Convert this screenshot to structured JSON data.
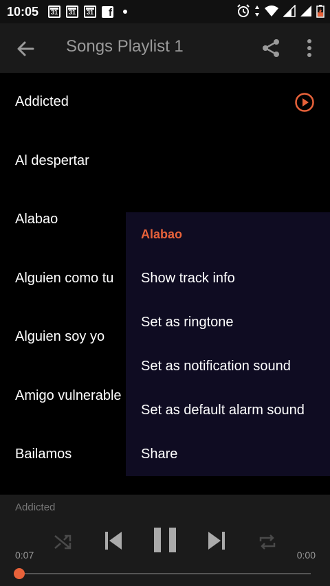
{
  "status_bar": {
    "time": "10:05",
    "calendar_day": "31",
    "icons": [
      "calendar-icon",
      "calendar-icon",
      "calendar-icon",
      "facebook-icon",
      "notification-dot-icon",
      "alarm-icon",
      "data-arrows-icon",
      "wifi-icon",
      "signal-icon",
      "signal-icon",
      "battery-charging-icon"
    ]
  },
  "toolbar": {
    "title": "Songs Playlist 1",
    "icons": [
      "back-arrow-icon",
      "share-icon",
      "more-vert-icon"
    ]
  },
  "songs": [
    {
      "title": "Addicted",
      "playing": true
    },
    {
      "title": "Al despertar"
    },
    {
      "title": "Alabao"
    },
    {
      "title": "Alguien como tu"
    },
    {
      "title": "Alguien soy yo"
    },
    {
      "title": "Amigo vulnerable"
    },
    {
      "title": "Bailamos"
    }
  ],
  "context_menu": {
    "header": "Alabao",
    "items": [
      "Show track info",
      "Set as ringtone",
      "Set as notification sound",
      "Set as default alarm sound",
      "Share"
    ]
  },
  "player": {
    "now_playing": "Addicted",
    "elapsed": "0:07",
    "duration": "0:00",
    "progress": 0.0,
    "controls": [
      "shuffle-icon",
      "skip-previous-icon",
      "pause-icon",
      "skip-next-icon",
      "repeat-icon"
    ]
  },
  "colors": {
    "accent": "#e8623a",
    "background": "#000000",
    "toolbar": "#1a1a1a",
    "menu": "#0f0c22",
    "player": "#1b1b1b"
  }
}
